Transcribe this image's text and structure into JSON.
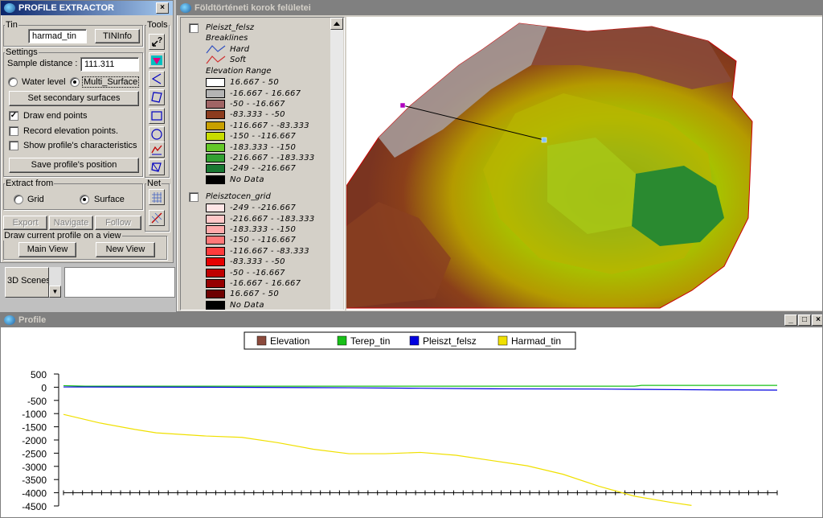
{
  "profile_extractor": {
    "title": "PROFILE EXTRACTOR",
    "close": "×",
    "tin_group": "Tin",
    "tin_value": "harmad_tin",
    "tininfo_button": "TINInfo",
    "tools_group": "Tools",
    "settings_group": "Settings",
    "sample_distance_label": "Sample distance :",
    "sample_distance_value": "111.311",
    "water_level": "Water level",
    "multi_surface": "Multi_Surface",
    "set_secondary": "Set secondary surfaces",
    "draw_end_points": "Draw end points",
    "record_elevation": "Record elevation points.",
    "show_characteristics": "Show profile's characteristics",
    "save_position": "Save profile's position",
    "extract_group": "Extract from",
    "grid": "Grid",
    "surface": "Surface",
    "net_group": "Net",
    "export": "Export",
    "navigate": "Navigate",
    "follow": "Follow",
    "draw_group": "Draw current profile on a view",
    "main_view": "Main View",
    "new_view": "New View",
    "check_mark": "✓",
    "help_icon_text": "?"
  },
  "scenes_list": {
    "item": "3D Scenes",
    "scroll_arrow": "▼"
  },
  "view_window": {
    "title": "Földtörténeti korok felületei",
    "minimize": "_",
    "maximize": "□",
    "close": "×",
    "legend": {
      "theme1": "Pleiszt_felsz",
      "breaklines": "Breaklines",
      "hard": "Hard",
      "soft": "Soft",
      "hard_color": "#3050c0",
      "soft_color": "#d03030",
      "elevation_range": "Elevation Range",
      "ranges1": [
        {
          "label": "16.667 - 50",
          "color": "#ffffff"
        },
        {
          "label": "-16.667 - 16.667",
          "color": "#b4b4b4"
        },
        {
          "label": "-50 - -16.667",
          "color": "#a06464"
        },
        {
          "label": "-83.333 - -50",
          "color": "#8c3c1e"
        },
        {
          "label": "-116.667 - -83.333",
          "color": "#c8a000"
        },
        {
          "label": "-150 - -116.667",
          "color": "#c8dc00"
        },
        {
          "label": "-183.333 - -150",
          "color": "#64c828"
        },
        {
          "label": "-216.667 - -183.333",
          "color": "#32a032"
        },
        {
          "label": "-249 - -216.667",
          "color": "#197832"
        },
        {
          "label": "No Data",
          "color": "#000000"
        }
      ],
      "theme2": "Pleisztocen_grid",
      "ranges2": [
        {
          "label": "-249 - -216.667",
          "color": "#ffe6e6"
        },
        {
          "label": "-216.667 - -183.333",
          "color": "#ffc8c8"
        },
        {
          "label": "-183.333 - -150",
          "color": "#ffaaaa"
        },
        {
          "label": "-150 - -116.667",
          "color": "#ff7878"
        },
        {
          "label": "-116.667 - -83.333",
          "color": "#ff3c3c"
        },
        {
          "label": "-83.333 - -50",
          "color": "#e60000"
        },
        {
          "label": "-50 - -16.667",
          "color": "#be0000"
        },
        {
          "label": "-16.667 - 16.667",
          "color": "#960000"
        },
        {
          "label": "16.667 - 50",
          "color": "#6e0000"
        },
        {
          "label": "No Data",
          "color": "#000000"
        }
      ]
    }
  },
  "profile_window": {
    "title": "Profile",
    "minimize": "_",
    "maximize": "□",
    "close": "×"
  },
  "chart_data": {
    "type": "line",
    "legend_placement": "top-center",
    "grid": false,
    "ylim": [
      -4500,
      500
    ],
    "y_ticks": [
      "500",
      "0",
      "-500",
      "-1000",
      "-1500",
      "-2000",
      "-2500",
      "-3000",
      "-3500",
      "-4000",
      "-4500"
    ],
    "y_tick_values": [
      500,
      0,
      -500,
      -1000,
      -1500,
      -2000,
      -2500,
      -3000,
      -3500,
      -4000,
      -4500
    ],
    "xlim": [
      0,
      100
    ],
    "series": [
      {
        "name": "Elevation",
        "color": "#8b4a3c",
        "x": [],
        "y": []
      },
      {
        "name": "Terep_tin",
        "color": "#18c018",
        "x": [
          0,
          3,
          20,
          50,
          80,
          81,
          100
        ],
        "y": [
          60,
          40,
          40,
          40,
          40,
          70,
          70
        ]
      },
      {
        "name": "Pleiszt_felsz",
        "color": "#0000e0",
        "x": [
          0,
          20,
          40,
          50,
          60,
          75,
          80,
          90,
          100
        ],
        "y": [
          10,
          0,
          -20,
          -40,
          -60,
          -70,
          -80,
          -100,
          -110
        ]
      },
      {
        "name": "Harmad_tin",
        "color": "#f0e000",
        "x": [
          0,
          5,
          10,
          13,
          20,
          25,
          30,
          35,
          40,
          45,
          50,
          55,
          60,
          65,
          70,
          75,
          80,
          85,
          88
        ],
        "y": [
          -1030,
          -1350,
          -1600,
          -1730,
          -1850,
          -1900,
          -2100,
          -2350,
          -2520,
          -2520,
          -2470,
          -2580,
          -2780,
          -2980,
          -3300,
          -3750,
          -4130,
          -4360,
          -4480
        ]
      }
    ]
  }
}
